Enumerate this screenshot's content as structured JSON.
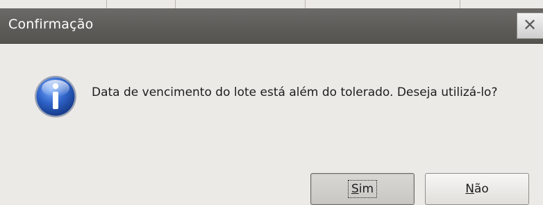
{
  "dialog": {
    "title": "Confirmação",
    "message": "Data de vencimento do lote está além do tolerado. Deseja utilizá-lo?",
    "icon": "information-icon",
    "close_icon": "close-icon"
  },
  "buttons": {
    "yes_label_mnemonic": "S",
    "yes_label_rest": "im",
    "no_label_mnemonic": "N",
    "no_label_rest": "ão"
  },
  "colors": {
    "titlebar": "#5c5b58",
    "body": "#eceae7",
    "icon_blue": "#2f63c9"
  }
}
